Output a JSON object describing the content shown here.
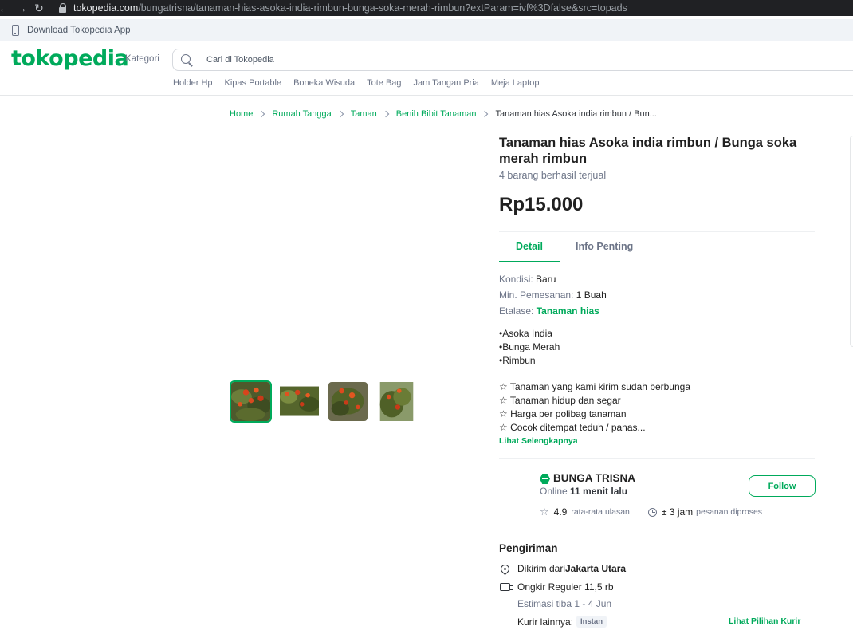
{
  "browser": {
    "url_domain": "tokopedia.com",
    "url_path": "/bungatrisna/tanaman-hias-asoka-india-rimbun-bunga-soka-merah-rimbun?extParam=ivf%3Dfalse&src=topads"
  },
  "app_strip": {
    "text": "Download Tokopedia App"
  },
  "header": {
    "logo": "tokopedia",
    "kategori": "Kategori",
    "search_placeholder": "Cari di Tokopedia",
    "quick_links": [
      "Holder Hp",
      "Kipas Portable",
      "Boneka Wisuda",
      "Tote Bag",
      "Jam Tangan Pria",
      "Meja Laptop"
    ]
  },
  "breadcrumb": {
    "items": [
      "Home",
      "Rumah Tangga",
      "Taman",
      "Benih Bibit Tanaman"
    ],
    "current": "Tanaman hias Asoka india rimbun / Bun..."
  },
  "product": {
    "title": "Tanaman hias Asoka india rimbun / Bunga soka merah rimbun",
    "sold": "4 barang berhasil terjual",
    "price": "Rp15.000",
    "tabs": [
      "Detail",
      "Info Penting"
    ],
    "specs": {
      "kondisi_label": "Kondisi: ",
      "kondisi_value": "Baru",
      "min_label": "Min. Pemesanan: ",
      "min_value": "1 Buah",
      "etalase_label": "Etalase: ",
      "etalase_value": "Tanaman hias"
    },
    "bullets": [
      "•Asoka India",
      "•Bunga Merah",
      "•Rimbun"
    ],
    "stars": [
      "☆ Tanaman yang kami kirim sudah berbunga",
      "☆ Tanaman hidup dan segar",
      "☆ Harga per polibag tanaman",
      "☆ Cocok ditempat teduh / panas..."
    ],
    "see_more": "Lihat Selengkapnya"
  },
  "shop": {
    "name": "BUNGA TRISNA",
    "online_prefix": "Online ",
    "online_time": "11 menit lalu",
    "follow": "Follow",
    "rating": "4.9",
    "rating_label": "rata-rata ulasan",
    "process_time": "± 3 jam",
    "process_label": "pesanan diproses"
  },
  "shipping": {
    "title": "Pengiriman",
    "from_prefix": "Dikirim dari ",
    "from_city": "Jakarta Utara",
    "ongkir": "Ongkir Reguler 11,5 rb",
    "estimate": "Estimasi tiba 1 - 4 Jun",
    "kurir_label": "Kurir lainnya:",
    "kurir_badge": "Instan",
    "kurir_link": "Lihat Pilihan Kurir"
  },
  "colors": {
    "brand": "#00aa5b",
    "text": "#212121",
    "muted": "#6d7588"
  }
}
